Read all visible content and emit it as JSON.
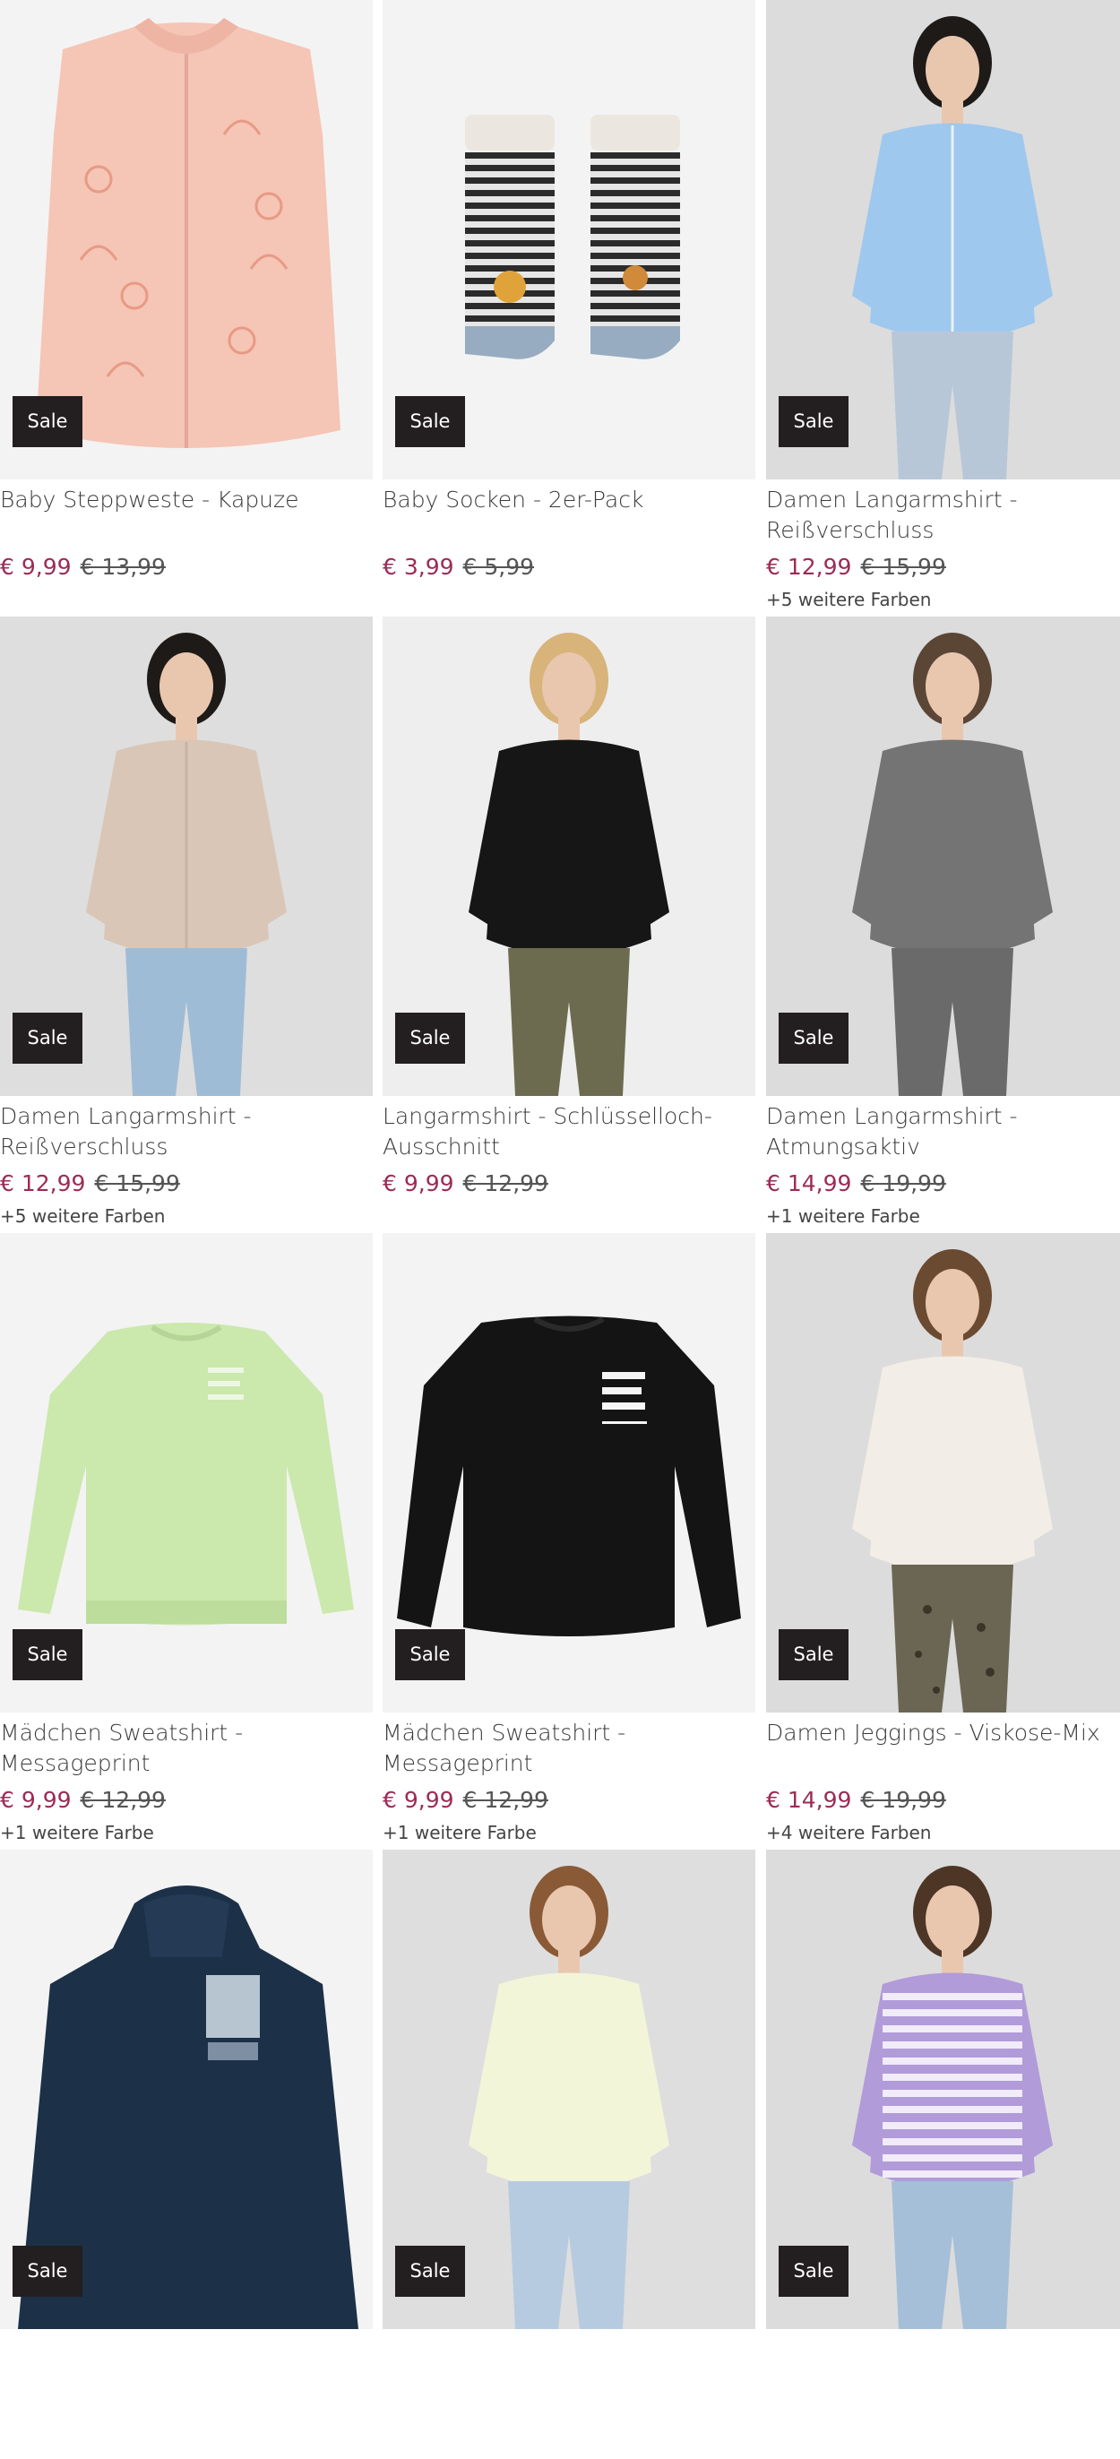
{
  "sale_label": "Sale",
  "colors": {
    "price_accent": "#9b2c55",
    "badge_bg": "#231f20",
    "image_bg": "#f3f3f3"
  },
  "products": [
    {
      "name": "Baby Steppweste - Kapuze",
      "price": "€ 9,99",
      "old_price": "€ 13,99",
      "more_colors": "",
      "image": "pink-vest-icon"
    },
    {
      "name": "Baby Socken - 2er-Pack",
      "price": "€ 3,99",
      "old_price": "€ 5,99",
      "more_colors": "",
      "image": "striped-socks-icon"
    },
    {
      "name": "Damen Langarmshirt - Reißverschluss",
      "price": "€ 12,99",
      "old_price": "€ 15,99",
      "more_colors": "+5 weitere Farben",
      "image": "model-blue-zip-shirt-icon"
    },
    {
      "name": "Damen Langarmshirt - Reißverschluss",
      "price": "€ 12,99",
      "old_price": "€ 15,99",
      "more_colors": "+5 weitere Farben",
      "image": "model-beige-zip-shirt-icon"
    },
    {
      "name": "Langarmshirt - Schlüsselloch-Ausschnitt",
      "price": "€ 9,99",
      "old_price": "€ 12,99",
      "more_colors": "",
      "image": "model-black-shirt-icon"
    },
    {
      "name": "Damen Langarmshirt - Atmungsaktiv",
      "price": "€ 14,99",
      "old_price": "€ 19,99",
      "more_colors": "+1 weitere Farbe",
      "image": "model-grey-sport-shirt-icon"
    },
    {
      "name": "Mädchen Sweatshirt - Messageprint",
      "price": "€ 9,99",
      "old_price": "€ 12,99",
      "more_colors": "+1 weitere Farbe",
      "image": "green-sweatshirt-icon"
    },
    {
      "name": "Mädchen Sweatshirt - Messageprint",
      "price": "€ 9,99",
      "old_price": "€ 12,99",
      "more_colors": "+1 weitere Farbe",
      "image": "black-sweatshirt-icon"
    },
    {
      "name": "Damen Jeggings - Viskose-Mix",
      "price": "€ 14,99",
      "old_price": "€ 19,99",
      "more_colors": "+4 weitere Farben",
      "image": "model-leopard-jeggings-icon"
    },
    {
      "name": "",
      "price": "",
      "old_price": "",
      "more_colors": "",
      "image": "navy-hoodie-icon"
    },
    {
      "name": "",
      "price": "",
      "old_price": "",
      "more_colors": "",
      "image": "model-cream-sweater-icon"
    },
    {
      "name": "",
      "price": "",
      "old_price": "",
      "more_colors": "",
      "image": "model-lilac-striped-shirt-icon"
    }
  ]
}
